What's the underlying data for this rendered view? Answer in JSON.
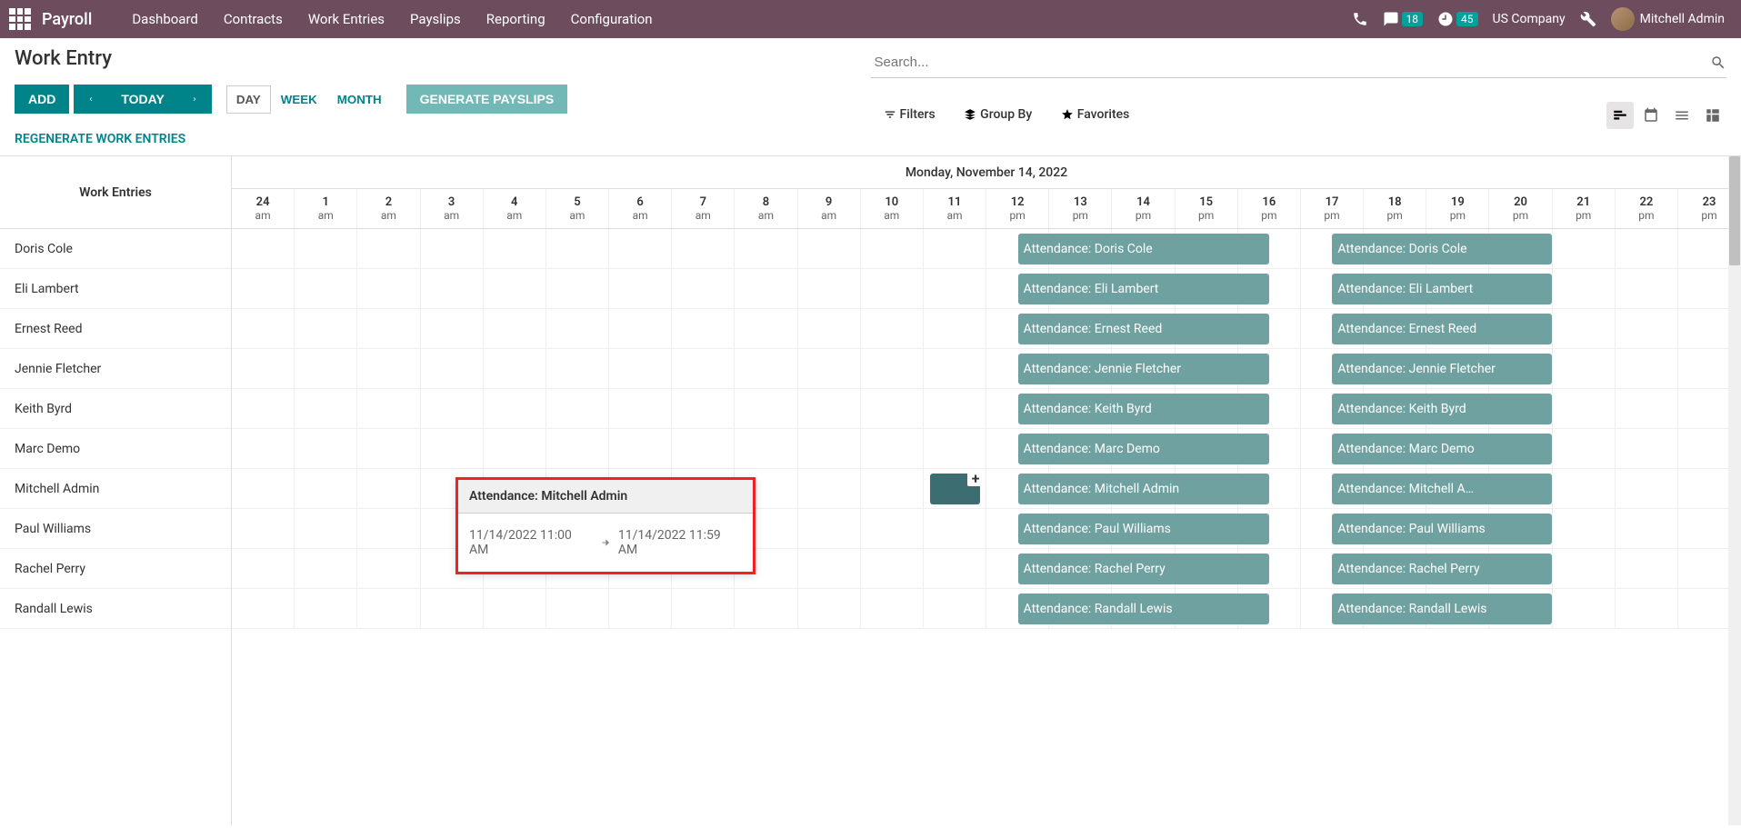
{
  "navbar": {
    "brand": "Payroll",
    "items": [
      "Dashboard",
      "Contracts",
      "Work Entries",
      "Payslips",
      "Reporting",
      "Configuration"
    ],
    "chat_badge": "18",
    "clock_badge": "45",
    "company": "US Company",
    "user": "Mitchell Admin"
  },
  "cp": {
    "title": "Work Entry",
    "add": "ADD",
    "today": "TODAY",
    "day": "DAY",
    "week": "WEEK",
    "month": "MONTH",
    "generate": "GENERATE PAYSLIPS",
    "regenerate": "REGENERATE WORK ENTRIES",
    "search_placeholder": "Search...",
    "filters": "Filters",
    "groupby": "Group By",
    "favorites": "Favorites"
  },
  "gantt": {
    "left_header": "Work Entries",
    "date_header": "Monday, November 14, 2022",
    "hours": [
      {
        "h": "24",
        "p": "am"
      },
      {
        "h": "1",
        "p": "am"
      },
      {
        "h": "2",
        "p": "am"
      },
      {
        "h": "3",
        "p": "am"
      },
      {
        "h": "4",
        "p": "am"
      },
      {
        "h": "5",
        "p": "am"
      },
      {
        "h": "6",
        "p": "am"
      },
      {
        "h": "7",
        "p": "am"
      },
      {
        "h": "8",
        "p": "am"
      },
      {
        "h": "9",
        "p": "am"
      },
      {
        "h": "10",
        "p": "am"
      },
      {
        "h": "11",
        "p": "am"
      },
      {
        "h": "12",
        "p": "pm"
      },
      {
        "h": "13",
        "p": "pm"
      },
      {
        "h": "14",
        "p": "pm"
      },
      {
        "h": "15",
        "p": "pm"
      },
      {
        "h": "16",
        "p": "pm"
      },
      {
        "h": "17",
        "p": "pm"
      },
      {
        "h": "18",
        "p": "pm"
      },
      {
        "h": "19",
        "p": "pm"
      },
      {
        "h": "20",
        "p": "pm"
      },
      {
        "h": "21",
        "p": "pm"
      },
      {
        "h": "22",
        "p": "pm"
      },
      {
        "h": "23",
        "p": "pm"
      }
    ],
    "rows": [
      {
        "name": "Doris Cole",
        "pill1": "Attendance: Doris Cole",
        "pill2": "Attendance: Doris Cole"
      },
      {
        "name": "Eli Lambert",
        "pill1": "Attendance: Eli Lambert",
        "pill2": "Attendance: Eli Lambert"
      },
      {
        "name": "Ernest Reed",
        "pill1": "Attendance: Ernest Reed",
        "pill2": "Attendance: Ernest Reed"
      },
      {
        "name": "Jennie Fletcher",
        "pill1": "Attendance: Jennie Fletcher",
        "pill2": "Attendance: Jennie Fletcher"
      },
      {
        "name": "Keith Byrd",
        "pill1": "Attendance: Keith Byrd",
        "pill2": "Attendance: Keith Byrd"
      },
      {
        "name": "Marc Demo",
        "pill1": "Attendance: Marc Demo",
        "pill2": "Attendance: Marc Demo"
      },
      {
        "name": "Mitchell Admin",
        "pill1": "Attendance: Mitchell Admin",
        "pill2": "Attendance: Mitchell A…",
        "has_new": true,
        "has_popup": true
      },
      {
        "name": "Paul Williams",
        "pill1": "Attendance: Paul Williams",
        "pill2": "Attendance: Paul Williams"
      },
      {
        "name": "Rachel Perry",
        "pill1": "Attendance: Rachel Perry",
        "pill2": "Attendance: Rachel Perry"
      },
      {
        "name": "Randall Lewis",
        "pill1": "Attendance: Randall Lewis",
        "pill2": "Attendance: Randall Lewis"
      }
    ]
  },
  "popup": {
    "title": "Attendance: Mitchell Admin",
    "start": "11/14/2022 11:00 AM",
    "end": "11/14/2022 11:59 AM"
  }
}
